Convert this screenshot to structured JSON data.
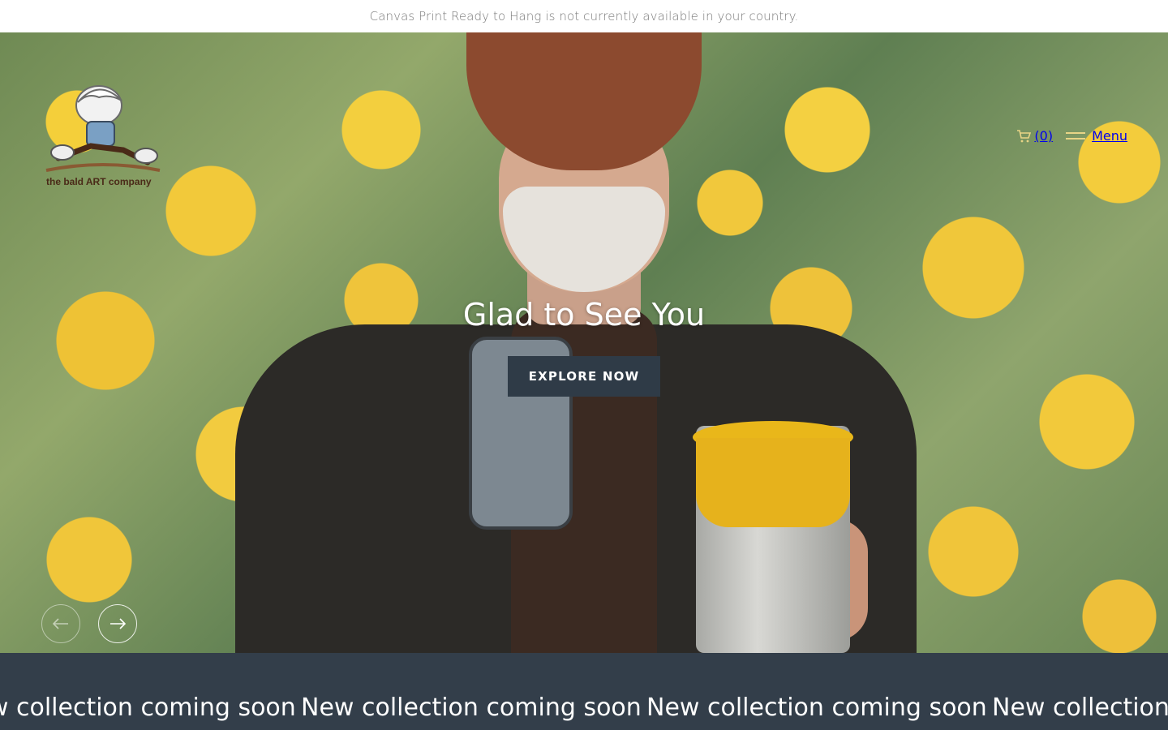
{
  "announcement": {
    "text": "Canvas Print Ready to Hang is not currently available in your country."
  },
  "brand": {
    "logo_text": "the bald ART company"
  },
  "header": {
    "cart_count": "(0)",
    "cart_icon": "cart-icon",
    "menu_label": "Menu",
    "menu_icon": "hamburger-icon"
  },
  "hero": {
    "title": "Glad to See You",
    "cta_label": "EXPLORE NOW",
    "prev_icon": "arrow-left-icon",
    "next_icon": "arrow-right-icon"
  },
  "marquee": {
    "items": [
      "New collection coming soon",
      "New collection coming soon",
      "New collection coming soon",
      "New collection coming soon"
    ]
  },
  "colors": {
    "announcement_text": "#7a7a7a",
    "button_bg": "#2f3b47",
    "marquee_bg": "#333e4a",
    "header_accent": "#e8d486"
  }
}
